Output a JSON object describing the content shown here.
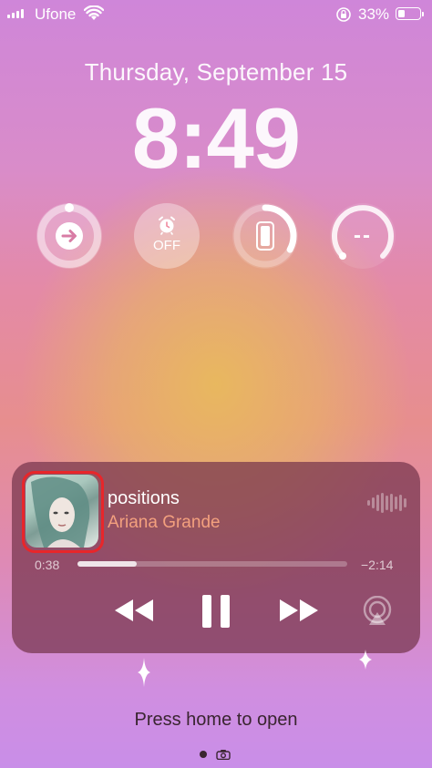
{
  "status_bar": {
    "carrier": "Ufone",
    "battery": "33%",
    "battery_level": 0.33
  },
  "lock_screen": {
    "date": "Thursday, September 15",
    "time": "8:49"
  },
  "widgets": [
    {
      "icon": "arrow-right-icon"
    },
    {
      "icon": "alarm-clock-icon",
      "label": "OFF"
    },
    {
      "icon": "phone-battery-icon"
    },
    {
      "label": "--"
    }
  ],
  "now_playing": {
    "title": "positions",
    "artist": "Ariana Grande",
    "elapsed": "0:38",
    "remaining": "−2:14",
    "progress": 0.22
  },
  "footer": {
    "hint": "Press home to open"
  },
  "colors": {
    "artist_accent": "#f3a07e",
    "highlight_box": "#e8262a",
    "player_bg": "#76344c"
  }
}
